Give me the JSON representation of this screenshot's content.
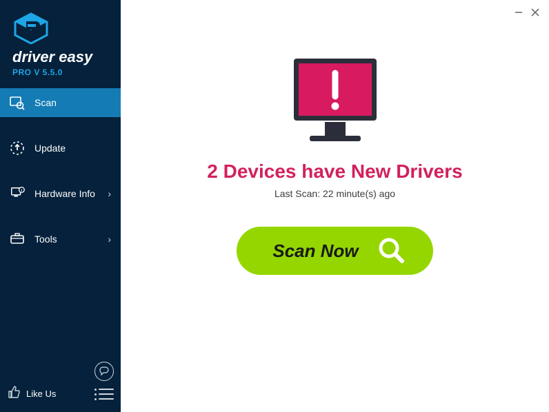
{
  "app": {
    "brand": "driver easy",
    "version": "PRO V 5.5.0"
  },
  "sidebar": {
    "items": [
      {
        "label": "Scan",
        "iconName": "scan-icon"
      },
      {
        "label": "Update",
        "iconName": "update-icon"
      },
      {
        "label": "Hardware Info",
        "iconName": "hardware-info-icon"
      },
      {
        "label": "Tools",
        "iconName": "tools-icon"
      }
    ],
    "likeLabel": "Like Us"
  },
  "main": {
    "headline": "2 Devices have New Drivers",
    "lastScan": "Last Scan: 22 minute(s) ago",
    "scanLabel": "Scan Now",
    "alertColor": "#d81b60",
    "accentColor": "#95d600"
  }
}
